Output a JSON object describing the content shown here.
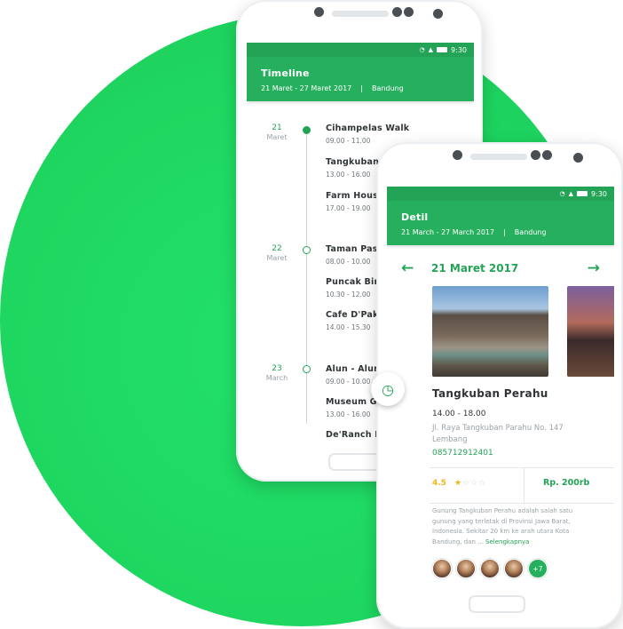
{
  "colors": {
    "brand_green": "#26b05d",
    "accent_green": "#23a355",
    "background_blob": "#1ed760",
    "star_yellow": "#f2b61a"
  },
  "status_bar": {
    "time": "9:30"
  },
  "timeline_screen": {
    "title": "Timeline",
    "date_range": "21 Maret - 27 Maret 2017",
    "separator": "|",
    "city": "Bandung",
    "days": [
      {
        "day": "21",
        "month": "Maret",
        "items": [
          {
            "name": "Cihampelas Walk",
            "time": "09.00 - 11.00"
          },
          {
            "name": "Tangkuban",
            "time": "13.00 - 16.00"
          },
          {
            "name": "Farm Hous",
            "time": "17.00 - 19.00"
          }
        ]
      },
      {
        "day": "22",
        "month": "Maret",
        "items": [
          {
            "name": "Taman Pas",
            "time": "08.00 - 10.00"
          },
          {
            "name": "Puncak Bin",
            "time": "10.30 - 12.00"
          },
          {
            "name": "Cafe D'Pak",
            "time": "14.00 - 15.30"
          }
        ]
      },
      {
        "day": "23",
        "month": "March",
        "items": [
          {
            "name": "Alun - Alun",
            "time": "09.00 - 10.00"
          },
          {
            "name": "Museum G",
            "time": "13.00 - 16.00"
          },
          {
            "name": "De'Ranch L",
            "time": ""
          }
        ]
      }
    ]
  },
  "detail_screen": {
    "title": "Detil",
    "date_range": "21 March - 27 March 2017",
    "separator": "|",
    "city": "Bandung",
    "current_date": "21 Maret 2017",
    "prev_icon": "arrow-left-icon",
    "next_icon": "arrow-right-icon",
    "place": {
      "name": "Tangkuban Perahu",
      "time": "14.00 - 18.00",
      "address": "Jl. Raya Tangkuban Parahu No. 147 Lembang",
      "phone": "085712912401",
      "rating": "4.5",
      "stars_filled": 1,
      "stars_total": 5,
      "price": "Rp. 200rb",
      "description": "Gunung Tangkuban Perahu adalah salah satu gunung yang terletak di Provinsi Jawa Barat, Indonesia. Sekitar 20 km ke arah utara Kota Bandung, dan ... ",
      "read_more": "Selengkapnya",
      "visitors_more": "+7"
    },
    "fab_icon": "history-icon"
  }
}
